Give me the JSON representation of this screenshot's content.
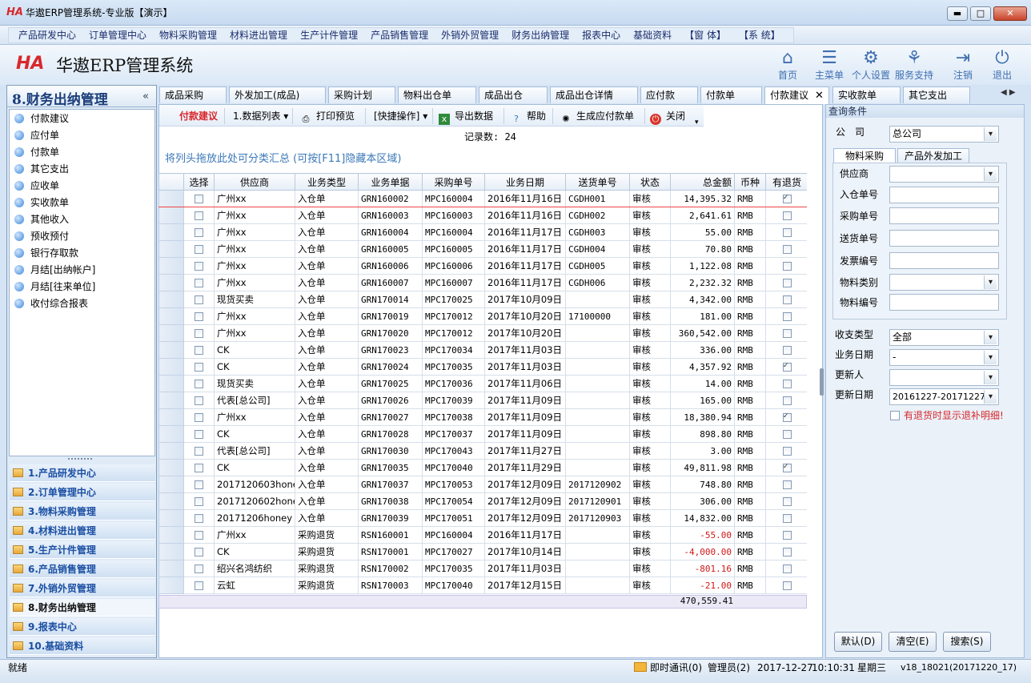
{
  "window": {
    "title": "华遨ERP管理系统-专业版【演示】",
    "logo_text": "HA",
    "min": "▬",
    "max": "□",
    "close": "✕"
  },
  "menu": [
    "产品研发中心",
    "订单管理中心",
    "物料采购管理",
    "材料进出管理",
    "生产计件管理",
    "产品销售管理",
    "外销外贸管理",
    "财务出纳管理",
    "报表中心",
    "基础资料",
    "【窗 体】",
    "【系 统】"
  ],
  "brand": {
    "logo": "HA",
    "title": "华遨ERP管理系统"
  },
  "tools": [
    {
      "label": "首页",
      "icon": "home-icon",
      "glyph": "⌂"
    },
    {
      "label": "主菜单",
      "icon": "list-icon",
      "glyph": "☰"
    },
    {
      "label": "个人设置",
      "icon": "gear-icon",
      "glyph": "⚙"
    },
    {
      "label": "服务支持",
      "icon": "support-icon",
      "glyph": "⚘"
    },
    {
      "label": "注销",
      "icon": "logout-icon",
      "glyph": "⇥"
    },
    {
      "label": "退出",
      "icon": "power-icon",
      "glyph": "⏻"
    }
  ],
  "left": {
    "title": "8.财务出纳管理",
    "collapse": "«",
    "items": [
      "付款建议",
      "应付单",
      "付款单",
      "其它支出",
      "应收单",
      "实收款单",
      "其他收入",
      "预收预付",
      "银行存取款",
      "月结[出纳帐户]",
      "月结[往来单位]",
      "收付综合报表"
    ],
    "modules": [
      "1.产品研发中心",
      "2.订单管理中心",
      "3.物料采购管理",
      "4.材料进出管理",
      "5.生产计件管理",
      "6.产品销售管理",
      "7.外销外贸管理",
      "8.财务出纳管理",
      "9.报表中心",
      "10.基础资料"
    ]
  },
  "tabs": [
    "成品采购",
    "外发加工(成品)",
    "采购计划",
    "物料出仓单",
    "成品出仓",
    "成品出仓详情",
    "应付款",
    "付款单",
    "付款建议",
    "实收款单",
    "其它支出"
  ],
  "tab_close": "✕",
  "tab_arrows": "◀ ▶",
  "toolbar": {
    "title": "付款建议",
    "list_view": "1.数据列表",
    "print_preview": "打印预览",
    "quick_ops": "[快捷操作]",
    "export": "导出数据",
    "help": "帮助",
    "generate": "生成应付款单",
    "close": "关闭"
  },
  "record_count": "记录数: 24",
  "group_hint": "将列头拖放此处可分类汇总 (可按[F11]隐藏本区域)",
  "grid": {
    "columns": [
      "",
      "选择",
      "供应商",
      "业务类型",
      "业务单据",
      "采购单号",
      "业务日期",
      "送货单号",
      "状态",
      "总金额",
      "币种",
      "有退货"
    ],
    "rows": [
      [
        "广州xx",
        "入仓单",
        "GRN160002",
        "MPC160004",
        "2016年11月16日",
        "CGDH001",
        "审核",
        "14,395.32",
        "RMB",
        true
      ],
      [
        "广州xx",
        "入仓单",
        "GRN160003",
        "MPC160003",
        "2016年11月16日",
        "CGDH002",
        "审核",
        "2,641.61",
        "RMB",
        false
      ],
      [
        "广州xx",
        "入仓单",
        "GRN160004",
        "MPC160004",
        "2016年11月17日",
        "CGDH003",
        "审核",
        "55.00",
        "RMB",
        false
      ],
      [
        "广州xx",
        "入仓单",
        "GRN160005",
        "MPC160005",
        "2016年11月17日",
        "CGDH004",
        "审核",
        "70.80",
        "RMB",
        false
      ],
      [
        "广州xx",
        "入仓单",
        "GRN160006",
        "MPC160006",
        "2016年11月17日",
        "CGDH005",
        "审核",
        "1,122.08",
        "RMB",
        false
      ],
      [
        "广州xx",
        "入仓单",
        "GRN160007",
        "MPC160007",
        "2016年11月17日",
        "CGDH006",
        "审核",
        "2,232.32",
        "RMB",
        false
      ],
      [
        "现货买卖",
        "入仓单",
        "GRN170014",
        "MPC170025",
        "2017年10月09日",
        "",
        "审核",
        "4,342.00",
        "RMB",
        false
      ],
      [
        "广州xx",
        "入仓单",
        "GRN170019",
        "MPC170012",
        "2017年10月20日",
        "17100000",
        "审核",
        "181.00",
        "RMB",
        false
      ],
      [
        "广州xx",
        "入仓单",
        "GRN170020",
        "MPC170012",
        "2017年10月20日",
        "",
        "审核",
        "360,542.00",
        "RMB",
        false
      ],
      [
        "CK",
        "入仓单",
        "GRN170023",
        "MPC170034",
        "2017年11月03日",
        "",
        "审核",
        "336.00",
        "RMB",
        false
      ],
      [
        "CK",
        "入仓单",
        "GRN170024",
        "MPC170035",
        "2017年11月03日",
        "",
        "审核",
        "4,357.92",
        "RMB",
        true
      ],
      [
        "现货买卖",
        "入仓单",
        "GRN170025",
        "MPC170036",
        "2017年11月06日",
        "",
        "审核",
        "14.00",
        "RMB",
        false
      ],
      [
        "代表[总公司]",
        "入仓单",
        "GRN170026",
        "MPC170039",
        "2017年11月09日",
        "",
        "审核",
        "165.00",
        "RMB",
        false
      ],
      [
        "广州xx",
        "入仓单",
        "GRN170027",
        "MPC170038",
        "2017年11月09日",
        "",
        "审核",
        "18,380.94",
        "RMB",
        true
      ],
      [
        "CK",
        "入仓单",
        "GRN170028",
        "MPC170037",
        "2017年11月09日",
        "",
        "审核",
        "898.80",
        "RMB",
        false
      ],
      [
        "代表[总公司]",
        "入仓单",
        "GRN170030",
        "MPC170043",
        "2017年11月27日",
        "",
        "审核",
        "3.00",
        "RMB",
        false
      ],
      [
        "CK",
        "入仓单",
        "GRN170035",
        "MPC170040",
        "2017年11月29日",
        "",
        "审核",
        "49,811.98",
        "RMB",
        true
      ],
      [
        "2017120603hone",
        "入仓单",
        "GRN170037",
        "MPC170053",
        "2017年12月09日",
        "2017120902",
        "审核",
        "748.80",
        "RMB",
        false
      ],
      [
        "2017120602hone",
        "入仓单",
        "GRN170038",
        "MPC170054",
        "2017年12月09日",
        "2017120901",
        "审核",
        "306.00",
        "RMB",
        false
      ],
      [
        "20171206honey",
        "入仓单",
        "GRN170039",
        "MPC170051",
        "2017年12月09日",
        "2017120903",
        "审核",
        "14,832.00",
        "RMB",
        false
      ],
      [
        "广州xx",
        "采购退货",
        "RSN160001",
        "MPC160004",
        "2016年11月17日",
        "",
        "审核",
        "-55.00",
        "RMB",
        false
      ],
      [
        "CK",
        "采购退货",
        "RSN170001",
        "MPC170027",
        "2017年10月14日",
        "",
        "审核",
        "-4,000.00",
        "RMB",
        false
      ],
      [
        "绍兴名鸿纺织",
        "采购退货",
        "RSN170002",
        "MPC170035",
        "2017年11月03日",
        "",
        "审核",
        "-801.16",
        "RMB",
        false
      ],
      [
        "云虹",
        "采购退货",
        "RSN170003",
        "MPC170040",
        "2017年12月15日",
        "",
        "审核",
        "-21.00",
        "RMB",
        false
      ]
    ],
    "total": "470,559.41"
  },
  "query": {
    "header": "查询条件",
    "company_label": "公　司",
    "company_value": "总公司",
    "tabs": [
      "物料采购",
      "产品外发加工"
    ],
    "fields": [
      {
        "label": "供应商",
        "value": "",
        "type": "select"
      },
      {
        "label": "入仓单号",
        "value": "",
        "type": "text"
      },
      {
        "label": "采购单号",
        "value": "",
        "type": "text"
      },
      {
        "label": "送货单号",
        "value": "",
        "type": "text"
      },
      {
        "label": "发票编号",
        "value": "",
        "type": "text"
      },
      {
        "label": "物料类别",
        "value": "",
        "type": "select"
      },
      {
        "label": "物料编号",
        "value": "",
        "type": "text"
      }
    ],
    "type_label": "收支类型",
    "type_value": "全部",
    "date_label": "业务日期",
    "date_value": "-",
    "updater_label": "更新人",
    "updater_value": "",
    "update_date_label": "更新日期",
    "update_date_value": "20161227-20171227",
    "show_refund": "有退货时显示退补明细!",
    "buttons": [
      "默认(D)",
      "清空(E)",
      "搜索(S)"
    ]
  },
  "status": {
    "ready": "就绪",
    "im": "即时通讯(0)",
    "user": "管理员(2)",
    "date": "2017-12-27",
    "time": "10:10:31",
    "weekday": "星期三",
    "version": "v18_18021(20171220_17)"
  },
  "colors": {
    "accent": "#d8282c",
    "link": "#3b78b8",
    "negative": "#d01818"
  }
}
